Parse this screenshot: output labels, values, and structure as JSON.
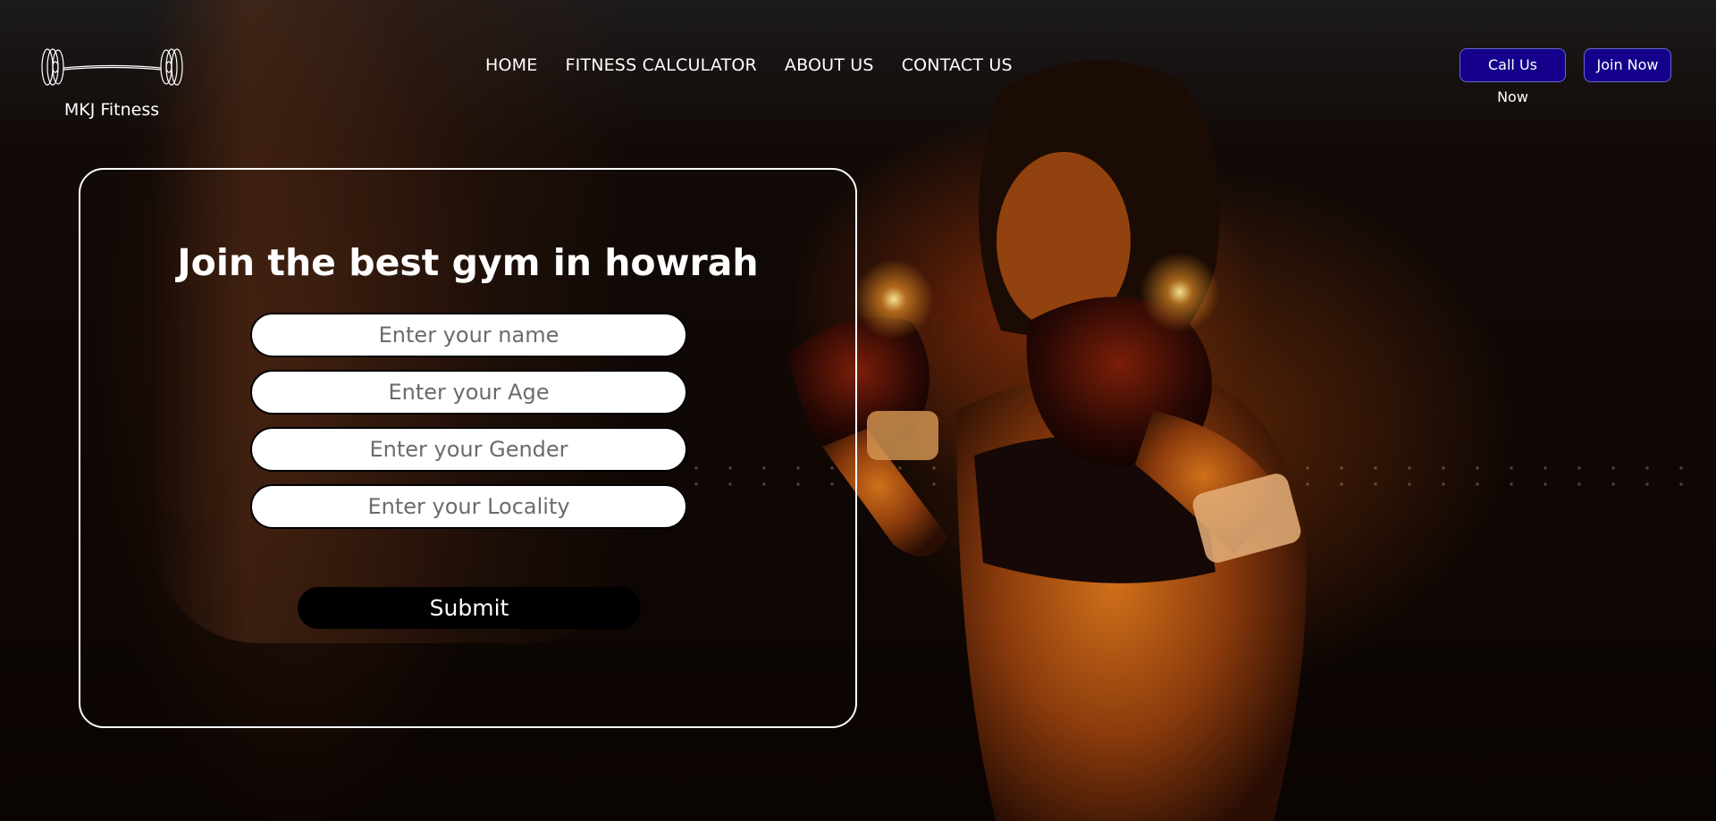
{
  "brand": {
    "name": "MKJ Fitness",
    "icon": "barbell-icon"
  },
  "nav": {
    "items": [
      {
        "label": "HOME"
      },
      {
        "label": "FITNESS CALCULATOR"
      },
      {
        "label": "ABOUT US"
      },
      {
        "label": "CONTACT US"
      }
    ]
  },
  "header_actions": {
    "call_label": "Call Us Now",
    "join_label": "Join Now"
  },
  "form": {
    "title": "Join the best gym in howrah",
    "name_placeholder": "Enter your name",
    "age_placeholder": "Enter your Age",
    "gender_placeholder": "Enter your Gender",
    "locality_placeholder": "Enter your Locality",
    "submit_label": "Submit"
  },
  "colors": {
    "button_bg": "#14008a",
    "submit_bg": "#000000",
    "text": "#ffffff"
  }
}
